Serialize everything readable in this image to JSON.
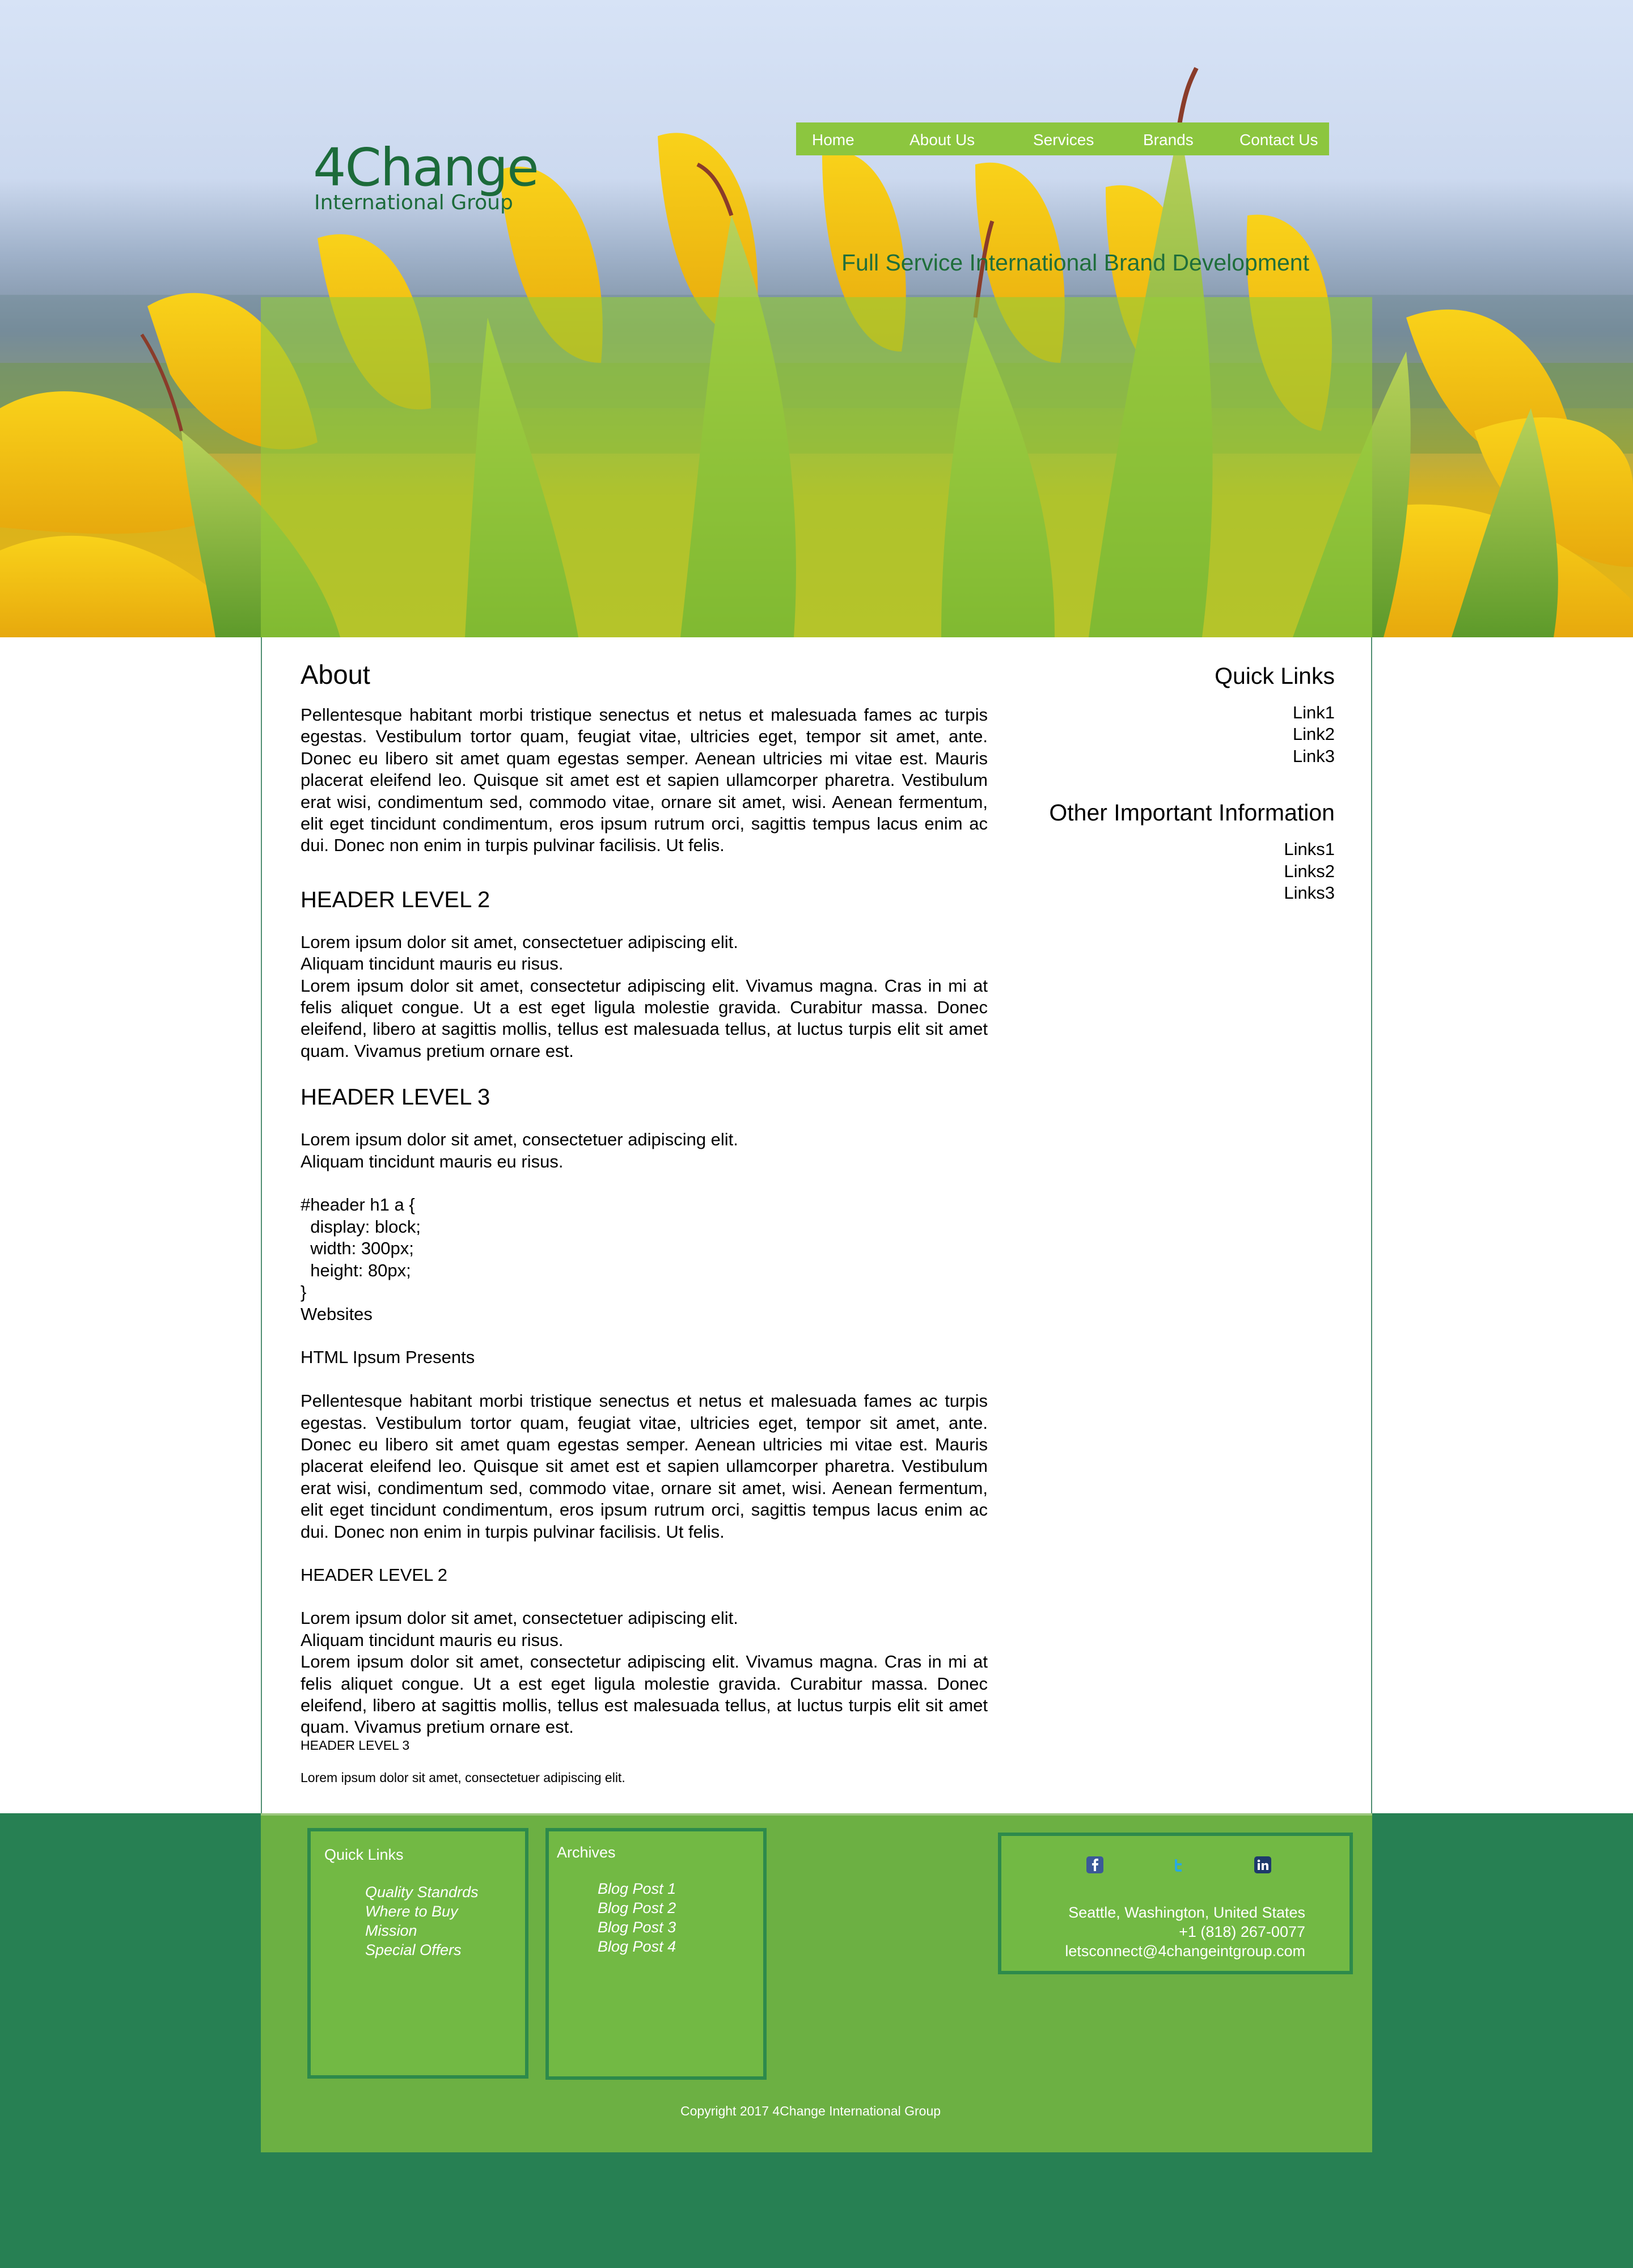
{
  "logo": {
    "main": "4Change",
    "sub": "International Group"
  },
  "nav": {
    "items": [
      "Home",
      "About Us",
      "Services",
      "Brands",
      "Contact Us"
    ]
  },
  "tagline": "Full Service International Brand Development",
  "main": {
    "about_title": "About",
    "about_text": "Pellentesque habitant morbi tristique senectus et netus et malesuada fames ac turpis egestas. Vestibulum tortor quam, feugiat vitae, ultricies eget, tempor sit amet, ante. Donec eu libero sit amet quam egestas semper. Aenean ultricies mi vitae est. Mauris placerat eleifend leo. Quisque sit amet est et sapien ullamcorper pharetra. Vestibulum erat wisi, condimentum sed, commodo vitae, ornare sit amet, wisi. Aenean fermentum, elit eget tincidunt condimentum, eros ipsum rutrum orci, sagittis tempus lacus enim ac dui. Donec non enim in turpis pulvinar facilisis. Ut felis.",
    "h2_title": "HEADER LEVEL 2",
    "h2_line1": "Lorem ipsum dolor sit amet, consectetuer adipiscing elit.",
    "h2_line2": "Aliquam tincidunt mauris eu risus.",
    "h2_para": "Lorem ipsum dolor sit amet, consectetur adipiscing elit. Vivamus magna. Cras in mi at felis aliquet congue. Ut a est eget ligula molestie gravida. Curabitur massa. Donec eleifend, libero at sagittis mollis, tellus est malesuada tellus, at luctus turpis elit sit amet quam. Vivamus pretium ornare est.",
    "h3_title": "HEADER LEVEL 3",
    "h3_line1": "Lorem ipsum dolor sit amet, consectetuer adipiscing elit.",
    "h3_line2": "Aliquam tincidunt mauris eu risus.",
    "code": "#header h1 a {\n  display: block;\n  width: 300px;\n  height: 80px;\n}",
    "websites": "Websites",
    "html_ipsum": "HTML Ipsum Presents",
    "para2": "Pellentesque habitant morbi tristique senectus et netus et malesuada fames ac turpis egestas. Vestibulum tortor quam, feugiat vitae, ultricies eget, tempor sit amet, ante. Donec eu libero sit amet quam egestas semper. Aenean ultricies mi vitae est. Mauris placerat eleifend leo. Quisque sit amet est et sapien ullamcorper pharetra. Vestibulum erat wisi, condimentum sed, commodo vitae, ornare sit amet, wisi. Aenean fermentum, elit eget tincidunt condimentum, eros ipsum rutrum orci, sagittis tempus lacus enim ac dui. Donec non enim in turpis pulvinar facilisis. Ut felis.",
    "h2b_title": "HEADER LEVEL 2",
    "h2b_line1": "Lorem ipsum dolor sit amet, consectetuer adipiscing elit.",
    "h2b_line2": "Aliquam tincidunt mauris eu risus.",
    "h2b_para": "Lorem ipsum dolor sit amet, consectetur adipiscing elit. Vivamus magna. Cras in mi at felis aliquet congue. Ut a est eget ligula molestie gravida. Curabitur massa. Donec eleifend, libero at sagittis mollis, tellus est malesuada tellus, at luctus turpis elit sit amet quam. Vivamus pretium ornare est.",
    "h3b_title": "HEADER LEVEL 3",
    "h3b_line": "Lorem ipsum dolor sit amet, consectetuer adipiscing elit."
  },
  "sidebar": {
    "quick_title": "Quick Links",
    "quick_links": [
      "Link1",
      "Link2",
      "Link3"
    ],
    "other_title": "Other Important Information",
    "other_links": [
      "Links1",
      "Links2",
      "Links3"
    ]
  },
  "footer": {
    "quick_title": "Quick Links",
    "quick_links": [
      "Quality Standrds",
      "Where to Buy",
      "Mission",
      "Special Offers"
    ],
    "archives_title": "Archives",
    "archives_links": [
      "Blog Post 1",
      "Blog Post 2",
      "Blog Post 3",
      "Blog Post 4"
    ],
    "location": "Seattle, Washington, United States",
    "phone": "+1 (818) 267-0077",
    "email": "letsconnect@4changeintgroup.com",
    "social": [
      "facebook-icon",
      "twitter-icon",
      "linkedin-icon"
    ],
    "copyright": "Copyright 2017 4Change International Group"
  },
  "colors": {
    "nav_bg": "#8cc63f",
    "brand_green": "#1c6b3a",
    "footer_band": "#278053",
    "footer_panel": "#6cb043",
    "footer_box_border": "#2d8a4b"
  }
}
